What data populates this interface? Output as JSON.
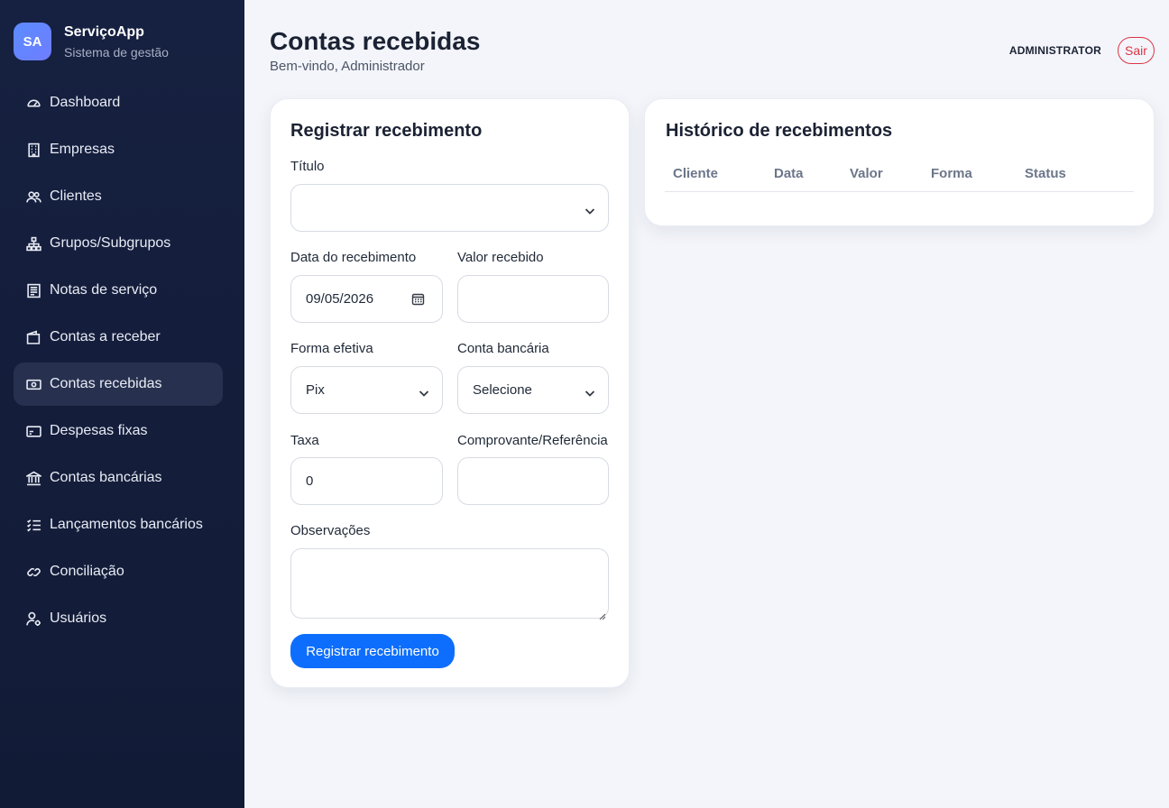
{
  "brand": {
    "initials": "SA",
    "name": "ServiçoApp",
    "subtitle": "Sistema de gestão"
  },
  "nav": [
    {
      "label": "Dashboard",
      "icon": "gauge-icon",
      "active": false
    },
    {
      "label": "Empresas",
      "icon": "building-icon",
      "active": false
    },
    {
      "label": "Clientes",
      "icon": "people-icon",
      "active": false
    },
    {
      "label": "Grupos/Subgrupos",
      "icon": "diagram-icon",
      "active": false
    },
    {
      "label": "Notas de serviço",
      "icon": "receipt-icon",
      "active": false
    },
    {
      "label": "Contas a receber",
      "icon": "wallet-icon",
      "active": false
    },
    {
      "label": "Contas recebidas",
      "icon": "cash-icon",
      "active": true
    },
    {
      "label": "Despesas fixas",
      "icon": "card-icon",
      "active": false
    },
    {
      "label": "Contas bancárias",
      "icon": "bank-icon",
      "active": false
    },
    {
      "label": "Lançamentos bancários",
      "icon": "list-check-icon",
      "active": false
    },
    {
      "label": "Conciliação",
      "icon": "link-icon",
      "active": false
    },
    {
      "label": "Usuários",
      "icon": "user-gear-icon",
      "active": false
    }
  ],
  "header": {
    "title": "Contas recebidas",
    "subtitle": "Bem-vindo, Administrador",
    "user": "ADMINISTRATOR",
    "logout": "Sair"
  },
  "form": {
    "title": "Registrar recebimento",
    "titulo_label": "Título",
    "titulo_value": "",
    "data_label": "Data do recebimento",
    "data_value": "09/05/2026",
    "valor_label": "Valor recebido",
    "valor_value": "",
    "forma_label": "Forma efetiva",
    "forma_value": "Pix",
    "conta_label": "Conta bancária",
    "conta_value": "Selecione",
    "taxa_label": "Taxa",
    "taxa_value": "0",
    "comprovante_label": "Comprovante/Referência",
    "comprovante_value": "",
    "obs_label": "Observações",
    "obs_value": "",
    "submit_label": "Registrar recebimento"
  },
  "history": {
    "title": "Histórico de recebimentos",
    "columns": [
      "Cliente",
      "Data",
      "Valor",
      "Forma",
      "Status"
    ],
    "rows": []
  },
  "colors": {
    "sidebar": "#162040",
    "accent": "#0d6efd",
    "danger": "#dc3545",
    "active_nav": "#27314f"
  }
}
